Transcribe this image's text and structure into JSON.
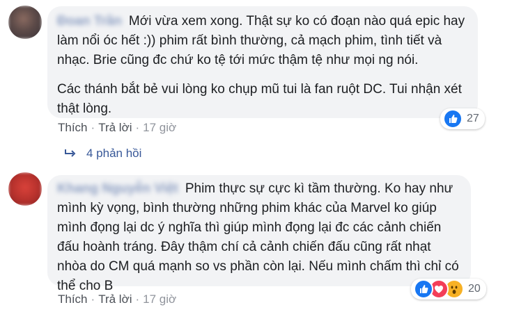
{
  "comments": [
    {
      "author": "Đoan Trần",
      "paragraphs": [
        "Mới vừa xem xong. Thật sự ko có đoạn nào quá epic hay làm nổi óc hết :)) phim rất bình thường, cả mạch phim, tình tiết và nhạc. Brie cũng đc chứ ko tệ tới mức thậm tệ như mọi ng nói.",
        "Các thánh bắt bẻ vui lòng ko chụp mũ tui là fan ruột DC. Tui nhận xét thật lòng."
      ],
      "like_label": "Thích",
      "reply_label": "Trả lời",
      "time": "17 giờ",
      "reaction_count": "27",
      "reactions": [
        "like-icon"
      ],
      "replies_label": "4 phản hồi"
    },
    {
      "author": "Khang Nguyễn Việt",
      "paragraphs": [
        "Phim thực sự cực kì tầm thường. Ko hay như mình kỳ vọng, bình thường những phim khác của Marvel ko giúp mình đọng lại dc ý nghĩa thì giúp mình đọng lại đc các cảnh chiến đấu hoành tráng. Đây thậm chí cả cảnh chiến đấu cũng rất nhạt nhòa do CM quá mạnh so vs phần còn lại. Nếu mình chấm thì chỉ có thể cho B"
      ],
      "like_label": "Thích",
      "reply_label": "Trả lời",
      "time": "17 giờ",
      "reaction_count": "20",
      "reactions": [
        "like-icon",
        "love-icon",
        "wow-icon"
      ]
    }
  ],
  "colors": {
    "link": "#385898",
    "bubble": "#f2f3f5",
    "like": "#1877f2",
    "love": "#f33e58",
    "wow": "#f7b125"
  }
}
